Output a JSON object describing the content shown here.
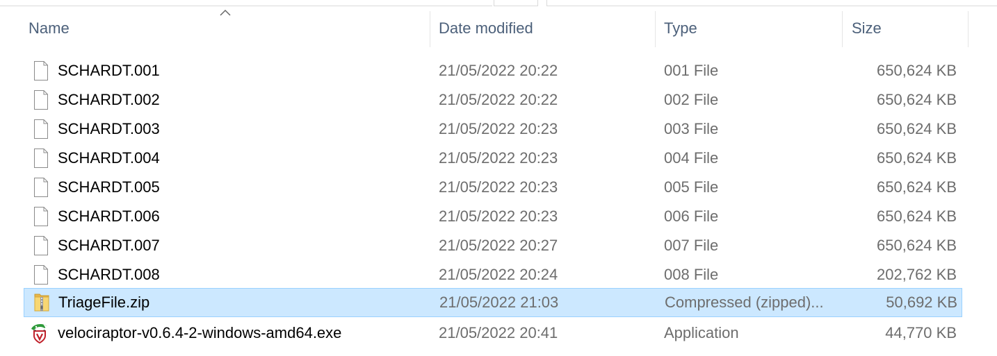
{
  "columns": {
    "name": "Name",
    "date": "Date modified",
    "type": "Type",
    "size": "Size",
    "sorted_by": "name",
    "sort_direction": "ascending"
  },
  "files": [
    {
      "name": "SCHARDT.001",
      "date": "21/05/2022 20:22",
      "type": "001 File",
      "size": "650,624 KB",
      "icon": "generic-file-icon",
      "selected": false
    },
    {
      "name": "SCHARDT.002",
      "date": "21/05/2022 20:22",
      "type": "002 File",
      "size": "650,624 KB",
      "icon": "generic-file-icon",
      "selected": false
    },
    {
      "name": "SCHARDT.003",
      "date": "21/05/2022 20:23",
      "type": "003 File",
      "size": "650,624 KB",
      "icon": "generic-file-icon",
      "selected": false
    },
    {
      "name": "SCHARDT.004",
      "date": "21/05/2022 20:23",
      "type": "004 File",
      "size": "650,624 KB",
      "icon": "generic-file-icon",
      "selected": false
    },
    {
      "name": "SCHARDT.005",
      "date": "21/05/2022 20:23",
      "type": "005 File",
      "size": "650,624 KB",
      "icon": "generic-file-icon",
      "selected": false
    },
    {
      "name": "SCHARDT.006",
      "date": "21/05/2022 20:23",
      "type": "006 File",
      "size": "650,624 KB",
      "icon": "generic-file-icon",
      "selected": false
    },
    {
      "name": "SCHARDT.007",
      "date": "21/05/2022 20:27",
      "type": "007 File",
      "size": "650,624 KB",
      "icon": "generic-file-icon",
      "selected": false
    },
    {
      "name": "SCHARDT.008",
      "date": "21/05/2022 20:24",
      "type": "008 File",
      "size": "202,762 KB",
      "icon": "generic-file-icon",
      "selected": false
    },
    {
      "name": "TriageFile.zip",
      "date": "21/05/2022 21:03",
      "type": "Compressed (zipped)...",
      "size": "50,692 KB",
      "icon": "zip-folder-icon",
      "selected": true
    },
    {
      "name": "velociraptor-v0.6.4-2-windows-amd64.exe",
      "date": "21/05/2022 20:41",
      "type": "Application",
      "size": "44,770 KB",
      "icon": "velociraptor-app-icon",
      "selected": false
    }
  ],
  "colors": {
    "header_text": "#4c607a",
    "secondary_text": "#6d6d6d",
    "selection_fill": "#cce8ff",
    "selection_border": "#99d1ff"
  }
}
